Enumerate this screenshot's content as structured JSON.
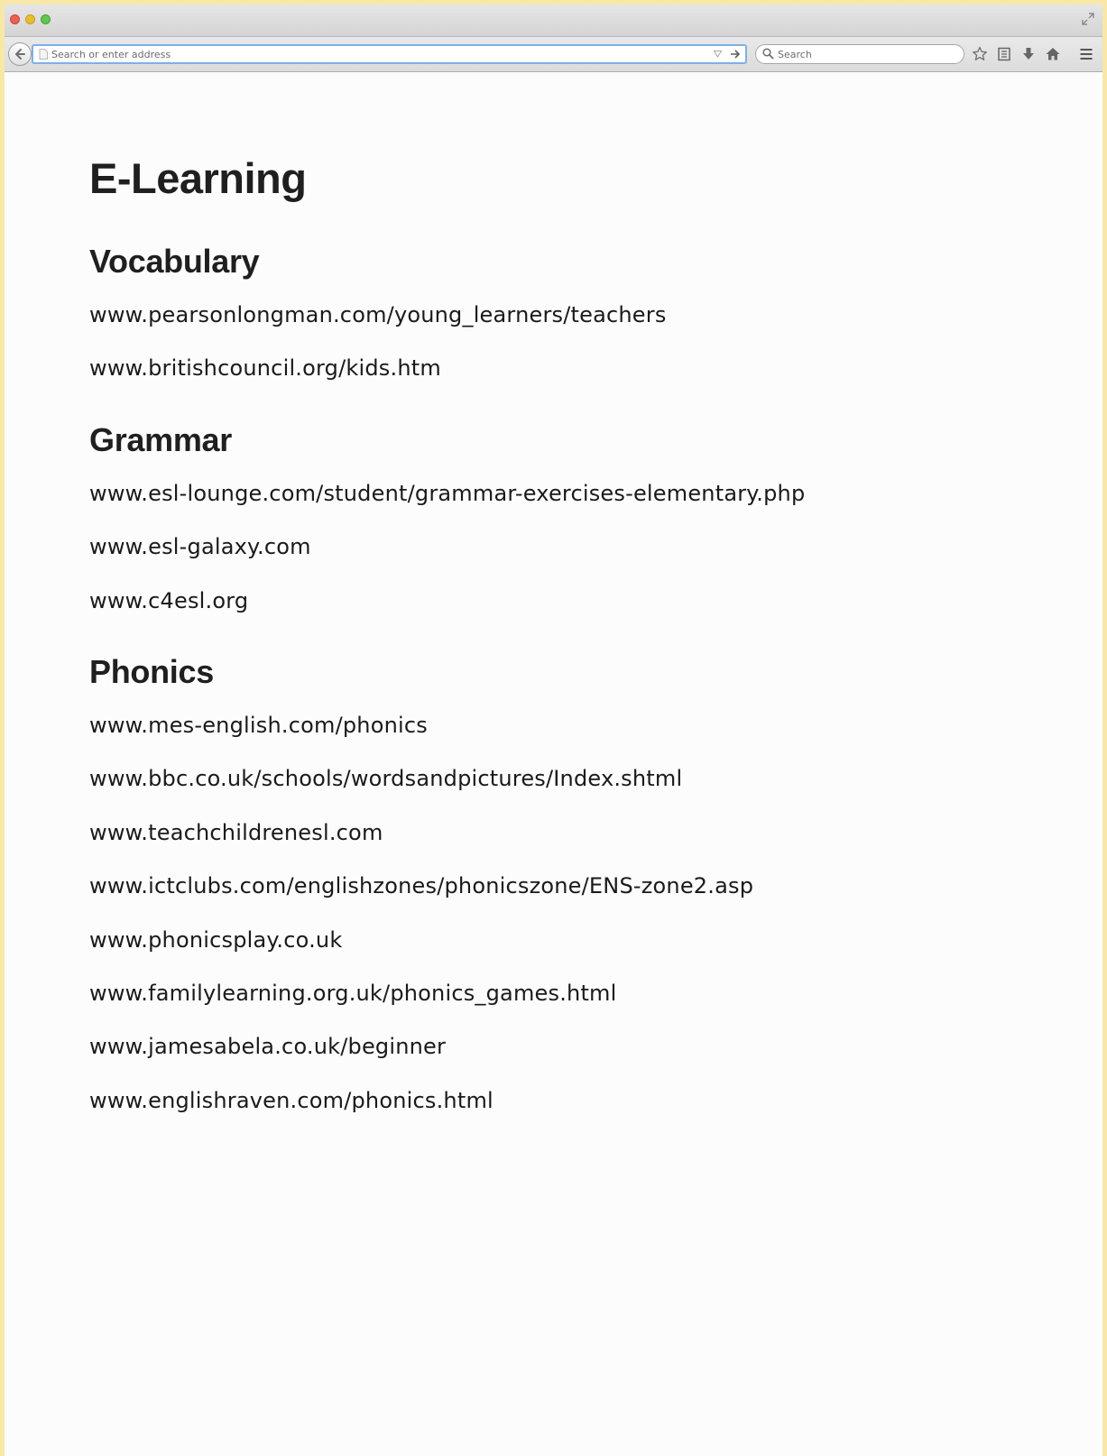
{
  "browser": {
    "address_bar": {
      "placeholder": "Search or enter address",
      "value": ""
    },
    "search_bar": {
      "placeholder": "Search"
    },
    "toolbar_icons": [
      "back-icon",
      "star-icon",
      "reading-list-icon",
      "download-icon",
      "home-icon",
      "menu-icon"
    ]
  },
  "page": {
    "title": "E-Learning",
    "sections": [
      {
        "heading": "Vocabulary",
        "links": [
          "www.pearsonlongman.com/young_learners/teachers",
          "www.britishcouncil.org/kids.htm"
        ]
      },
      {
        "heading": "Grammar",
        "links": [
          "www.esl-lounge.com/student/grammar-exercises-elementary.php",
          "www.esl-galaxy.com",
          "www.c4esl.org"
        ]
      },
      {
        "heading": "Phonics",
        "links": [
          "www.mes-english.com/phonics",
          "www.bbc.co.uk/schools/wordsandpictures/Index.shtml",
          "www.teachchildrenesl.com",
          "www.ictclubs.com/englishzones/phonicszone/ENS-zone2.asp",
          "www.phonicsplay.co.uk",
          "www.familylearning.org.uk/phonics_games.html",
          "www.jamesabela.co.uk/beginner",
          "www.englishraven.com/phonics.html"
        ]
      }
    ]
  },
  "colors": {
    "frame": "#f8e7a9",
    "page_background": "#fcfcfc",
    "text": "#1f1f1f",
    "focus_ring": "#7eb0e6"
  }
}
